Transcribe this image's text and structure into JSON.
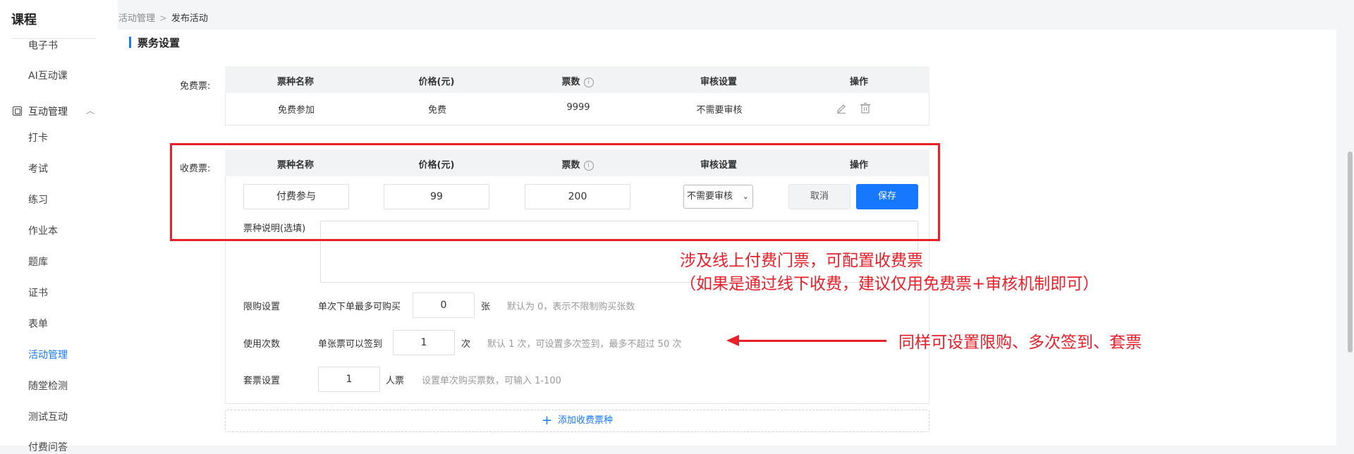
{
  "sidebar": {
    "title": "课程",
    "items_top": [
      "电子书",
      "AI互动课"
    ],
    "group_label": "互动管理",
    "group_chevron": "︿",
    "items": [
      "打卡",
      "考试",
      "练习",
      "作业本",
      "题库",
      "证书",
      "表单",
      "活动管理",
      "随堂检测",
      "测试互动",
      "付费问答"
    ]
  },
  "breadcrumb": {
    "parent": "活动管理",
    "separator": ">",
    "current": "发布活动"
  },
  "section_title": "票务设置",
  "free_ticket": {
    "label": "免费票:",
    "headers": [
      "票种名称",
      "价格(元)",
      "票数",
      "审核设置",
      "操作"
    ],
    "row": {
      "name": "免费参加",
      "price": "免费",
      "count": "9999",
      "review": "不需要审核"
    }
  },
  "paid_ticket": {
    "label": "收费票:",
    "headers": [
      "票种名称",
      "价格(元)",
      "票数",
      "审核设置",
      "操作"
    ],
    "name_value": "付费参与",
    "price_value": "99",
    "count_value": "200",
    "review_select": "不需要审核",
    "cancel_label": "取消",
    "save_label": "保存",
    "desc_label": "票种说明(选填)",
    "limit": {
      "label": "限购设置",
      "prefix": "单次下单最多可购买",
      "value": "0",
      "unit": "张",
      "hint": "默认为 0，表示不限制购买张数"
    },
    "usage": {
      "label": "使用次数",
      "prefix": "单张票可以签到",
      "value": "1",
      "unit": "次",
      "hint": "默认 1 次，可设置多次签到，最多不超过 50 次"
    },
    "package": {
      "label": "套票设置",
      "value": "1",
      "unit": "人票",
      "hint": "设置单次购买票数，可输入 1-100"
    }
  },
  "add_ticket_label": "添加收费票种",
  "annotations": {
    "line1": "涉及线上付费门票，可配置收费票",
    "line2": "（如果是通过线下收费，建议仅用免费票+审核机制即可）",
    "line3": "同样可设置限购、多次签到、套票"
  },
  "icons": {
    "info": "info-circle-icon",
    "edit": "edit-pencil-icon",
    "delete": "trash-icon",
    "add": "plus-icon"
  },
  "colors": {
    "accent": "#1677ff",
    "annotation": "#e8202a"
  }
}
